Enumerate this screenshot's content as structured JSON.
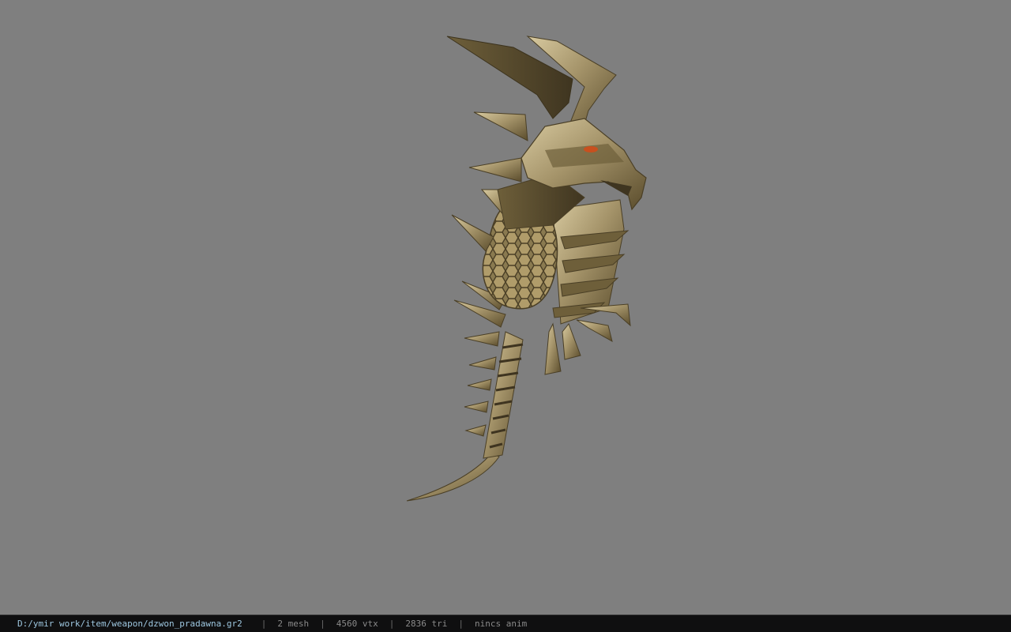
{
  "status_bar": {
    "file_path": "D:/ymir work/item/weapon/dzwon_pradawna.gr2",
    "separator": "|",
    "mesh_count": "2 mesh",
    "vertex_count": "4560 vtx",
    "triangle_count": "2836 tri",
    "anim_status": "nincs anim"
  },
  "viewport": {
    "background_color": "#7f7f7f",
    "model_subject": "golden-dragon-weapon",
    "model_colors": {
      "base": "#9a8a5c",
      "highlight": "#d6c79a",
      "shadow": "#4a3f26",
      "eye": "#c8501e"
    }
  }
}
